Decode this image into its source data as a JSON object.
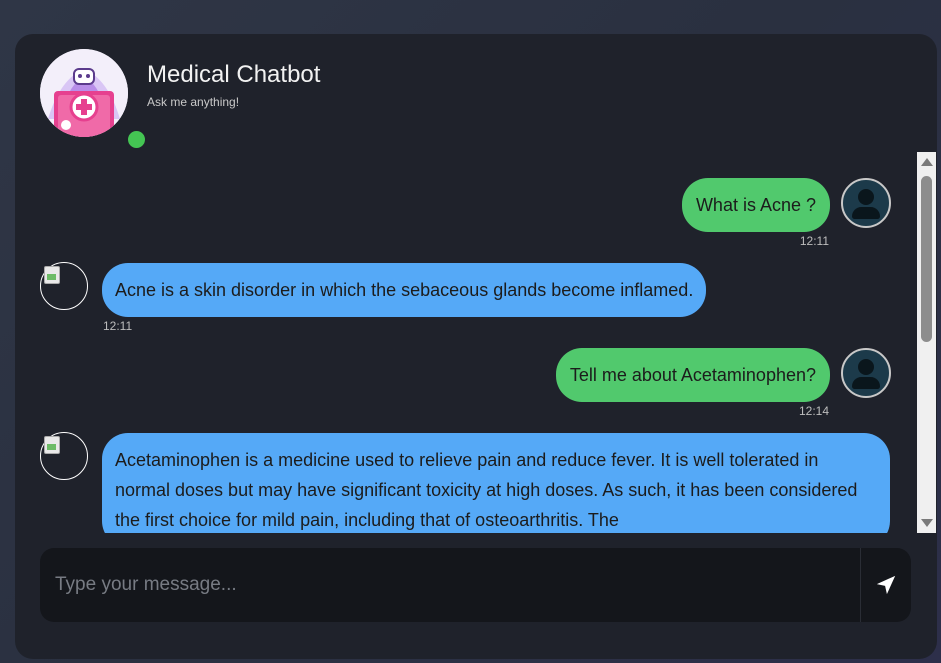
{
  "header": {
    "title": "Medical Chatbot",
    "subtitle": "Ask me anything!"
  },
  "messages": [
    {
      "sender": "user",
      "text": "What is Acne ?",
      "time": "12:11"
    },
    {
      "sender": "bot",
      "text": "Acne is a skin disorder in which the sebaceous glands become inflamed.",
      "time": "12:11"
    },
    {
      "sender": "user",
      "text": "Tell me about Acetaminophen?",
      "time": "12:14"
    },
    {
      "sender": "bot",
      "text": "Acetaminophen is a medicine used to relieve pain and reduce fever. It is well tolerated in normal doses but may have significant toxicity at high doses. As such, it has been considered the first choice for mild pain, including that of osteoarthritis. The",
      "time": ""
    }
  ],
  "composer": {
    "placeholder": "Type your message...",
    "value": ""
  },
  "icons": {
    "send": "paper-plane-icon",
    "user_avatar": "user-avatar-icon",
    "bot_avatar": "robot-doctor-icon"
  },
  "colors": {
    "user_bubble": "#51c96d",
    "bot_bubble": "#55a9f7",
    "online_status": "#44c553",
    "card_background": "#1f222b"
  }
}
